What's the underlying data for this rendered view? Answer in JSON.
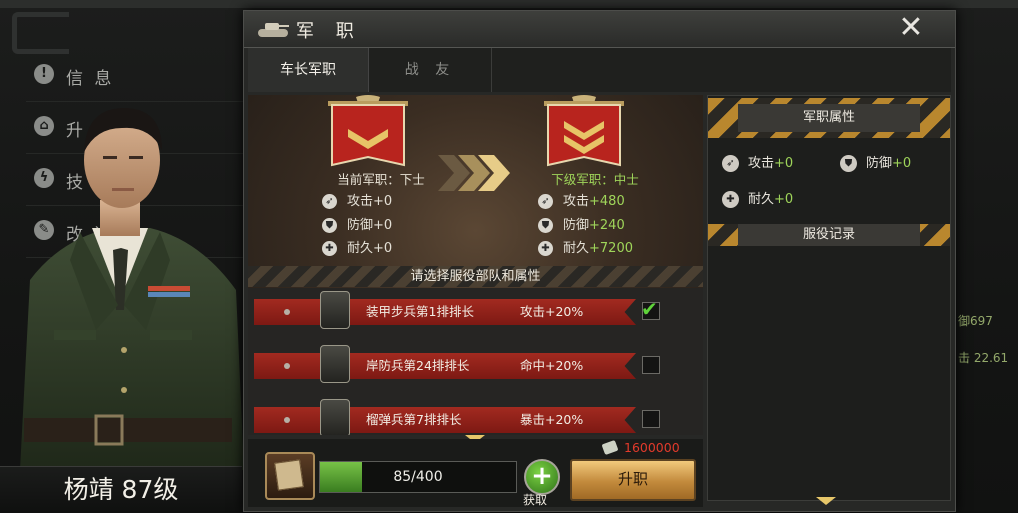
{
  "sidebar": {
    "items": [
      {
        "icon": "!",
        "icon_name": "info-icon",
        "label": "信 息"
      },
      {
        "icon": "⌂",
        "icon_name": "upgrade-icon",
        "label": "升 级"
      },
      {
        "icon": "ϟ",
        "icon_name": "skill-icon",
        "label": "技 能"
      },
      {
        "icon": "✎",
        "icon_name": "modify-icon",
        "label": "改 造"
      }
    ]
  },
  "bg_stats": {
    "defense": "御697",
    "hit": "击 22.61"
  },
  "commander": {
    "name_level": "杨靖 87级"
  },
  "dialog": {
    "title": "军 职",
    "close_label": "✕",
    "tabs": [
      {
        "label": "车长军职",
        "active": true
      },
      {
        "label": "战 友",
        "active": false
      }
    ],
    "current_rank": {
      "caption": "当前军职：下士",
      "stats": [
        {
          "icon": "attack-icon",
          "label": "攻击",
          "value": "+0"
        },
        {
          "icon": "defense-icon",
          "label": "防御",
          "value": "+0"
        },
        {
          "icon": "durability-icon",
          "label": "耐久",
          "value": "+0"
        }
      ]
    },
    "next_rank": {
      "caption": "下级军职：中士",
      "stats": [
        {
          "icon": "attack-icon",
          "label": "攻击",
          "value": "+480"
        },
        {
          "icon": "defense-icon",
          "label": "防御",
          "value": "+240"
        },
        {
          "icon": "durability-icon",
          "label": "耐久",
          "value": "+7200"
        }
      ]
    },
    "select_header": "请选择服役部队和属性",
    "units": [
      {
        "unit": "装甲步兵第1排排长",
        "bonus": "攻击+20%",
        "checked": true
      },
      {
        "unit": "岸防兵第24排排长",
        "bonus": "命中+20%",
        "checked": false
      },
      {
        "unit": "榴弹兵第7排排长",
        "bonus": "暴击+20%",
        "checked": false
      }
    ],
    "attributes_header": "军职属性",
    "attributes": [
      {
        "icon": "attack-icon",
        "label": "攻击",
        "value": "+0"
      },
      {
        "icon": "defense-icon",
        "label": "防御",
        "value": "+0"
      },
      {
        "icon": "durability-icon",
        "label": "耐久",
        "value": "+0"
      }
    ],
    "service_record_header": "服役记录",
    "progress": {
      "text": "85/400",
      "fraction": 0.2125
    },
    "get_label": "获取",
    "cost": "1600000",
    "promote_label": "升职",
    "colors": {
      "accent_green": "#9fd55a",
      "cost_red": "#e23a2b",
      "hazard_yellow": "#b9872e"
    }
  }
}
